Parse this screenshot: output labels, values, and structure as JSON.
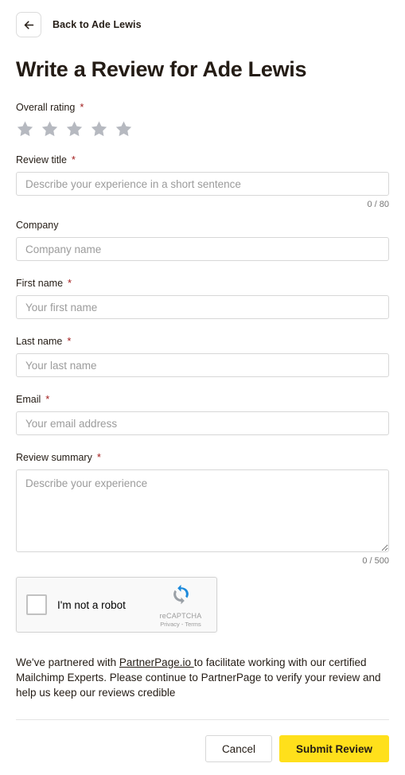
{
  "header": {
    "back_icon": "arrow-left-icon",
    "back_label": "Back to Ade Lewis"
  },
  "title": "Write a Review for Ade Lewis",
  "form": {
    "rating": {
      "label": "Overall rating",
      "required_mark": "*",
      "star_count": 5,
      "filled": 0,
      "star_color": "#b6b9c0"
    },
    "fields": [
      {
        "name": "review-title",
        "label": "Review title",
        "required_mark": "*",
        "placeholder": "Describe your experience in a short sentence",
        "value": "",
        "counter": "0 / 80"
      },
      {
        "name": "company",
        "label": "Company",
        "required_mark": "",
        "placeholder": "Company name",
        "value": "",
        "counter": ""
      },
      {
        "name": "first-name",
        "label": "First name",
        "required_mark": "*",
        "placeholder": "Your first name",
        "value": "",
        "counter": ""
      },
      {
        "name": "last-name",
        "label": "Last name",
        "required_mark": "*",
        "placeholder": "Your last name",
        "value": "",
        "counter": ""
      },
      {
        "name": "email",
        "label": "Email",
        "required_mark": "*",
        "placeholder": "Your email address",
        "value": "",
        "counter": ""
      }
    ],
    "summary": {
      "name": "review-summary",
      "label": "Review summary",
      "required_mark": "*",
      "placeholder": "Describe your experience",
      "value": "",
      "counter": "0 / 500"
    }
  },
  "recaptcha": {
    "checkbox_label": "I'm not a robot",
    "brand": "reCAPTCHA",
    "links": "Privacy - Terms",
    "logo_icon": "recaptcha-logo-icon",
    "checked": false
  },
  "note": {
    "before_link": "We've partnered with ",
    "link_text": "PartnerPage.io ",
    "after_link": "to facilitate working with our certified Mailchimp Experts. Please continue to PartnerPage to verify your review and help us keep our reviews credible"
  },
  "footer": {
    "cancel_label": "Cancel",
    "submit_label": "Submit Review",
    "submit_color": "#ffe01b"
  }
}
